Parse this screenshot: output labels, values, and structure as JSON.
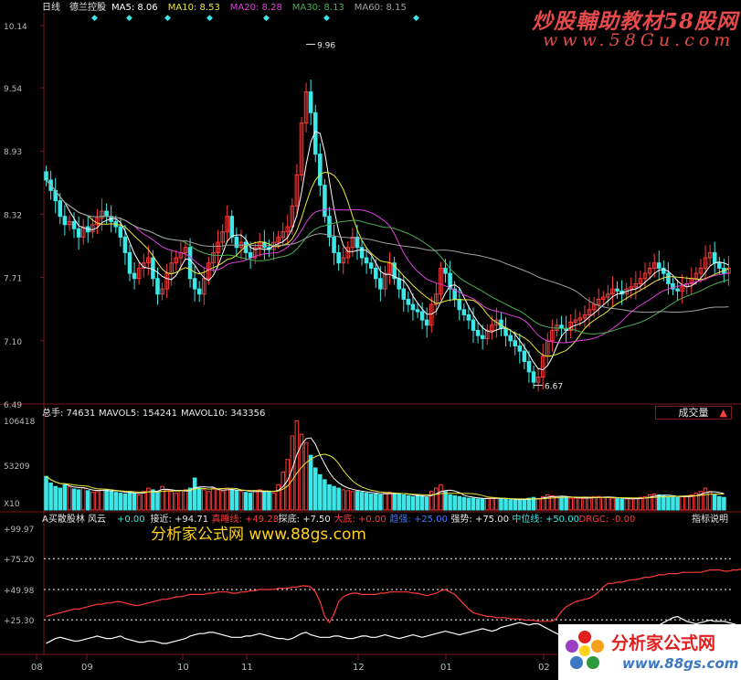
{
  "colors": {
    "up": "#ff3b3b",
    "down": "#3de7e7",
    "white": "#ffffff",
    "yellow": "#e8e83a",
    "magenta": "#e040e0",
    "green": "#4caf50",
    "grid": "#7a1a1a",
    "axis_text": "#b9b9b9"
  },
  "header": {
    "period": "日线",
    "stock": "德兰控股",
    "ma": [
      {
        "label": "MA5: 8.06",
        "color": "#ffffff"
      },
      {
        "label": "MA10: 8.53",
        "color": "#e8e83a"
      },
      {
        "label": "MA20: 8.28",
        "color": "#e040e0"
      },
      {
        "label": "MA30: 8.13",
        "color": "#4caf50"
      },
      {
        "label": "MA60: 8.15",
        "color": "#a0a0a0"
      }
    ]
  },
  "watermark": {
    "line1": "炒股輔助教材58股网",
    "line2": "www.58Gu.com",
    "line3": "分析家公式网 www.88gs.com"
  },
  "logo": {
    "title": "分析家公式网",
    "url": "www.88gs.com"
  },
  "volume_header": {
    "total": "总手: 74631",
    "mavol5": "MAVOL5: 154241",
    "mavol10": "MAVOL10: 343356",
    "button": "成交量",
    "button_icon": "▲"
  },
  "indicator_header": {
    "name": "A买散股林 风云",
    "items": [
      {
        "label": "+0.00",
        "color": "#3de7e7"
      },
      {
        "label": "接近: +94.71",
        "color": "#e8e8e8"
      },
      {
        "label": "真睡线: +49.28",
        "color": "#ff3b3b"
      },
      {
        "label": "探底: +7.50",
        "color": "#e8e8e8"
      },
      {
        "label": "大底: +0.00",
        "color": "#ff3b3b"
      },
      {
        "label": "趋强: +25.00",
        "color": "#3b78ff"
      },
      {
        "label": "强势: +75.00",
        "color": "#e8e8e8"
      },
      {
        "label": "中位线: +50.00",
        "color": "#3de7e7"
      },
      {
        "label": "DRGC: -0.00",
        "color": "#ff3b3b"
      }
    ],
    "help": "指标说明"
  },
  "chart_data": [
    {
      "type": "candlestick",
      "title": "德兰控股 日线",
      "yticks": [
        "10.14",
        "9.54",
        "8.93",
        "8.32",
        "7.71",
        "7.10",
        "6.49"
      ],
      "ylim": [
        6.49,
        10.14
      ],
      "annotations": [
        {
          "label": "9.96",
          "value": 9.96
        },
        {
          "label": "6.67",
          "value": 6.67
        }
      ],
      "closes": [
        8.65,
        8.55,
        8.45,
        8.3,
        8.22,
        8.25,
        8.18,
        8.1,
        8.2,
        8.15,
        8.22,
        8.28,
        8.35,
        8.3,
        8.25,
        8.2,
        8.1,
        7.95,
        7.75,
        7.7,
        7.8,
        7.85,
        7.9,
        7.7,
        7.55,
        7.6,
        7.75,
        7.85,
        7.9,
        7.95,
        8.0,
        7.7,
        7.6,
        7.55,
        7.7,
        7.85,
        7.95,
        8.05,
        8.15,
        8.3,
        8.1,
        8.0,
        8.05,
        7.95,
        7.9,
        8.0,
        8.05,
        8.0,
        7.98,
        8.05,
        8.1,
        8.15,
        8.2,
        8.4,
        8.7,
        9.2,
        9.5,
        9.3,
        8.9,
        8.6,
        8.3,
        8.1,
        7.95,
        7.85,
        7.9,
        8.0,
        8.1,
        8.0,
        7.9,
        7.85,
        7.8,
        7.7,
        7.6,
        7.75,
        7.85,
        7.7,
        7.6,
        7.5,
        7.45,
        7.4,
        7.38,
        7.3,
        7.25,
        7.45,
        7.55,
        7.8,
        7.75,
        7.6,
        7.5,
        7.4,
        7.35,
        7.3,
        7.2,
        7.15,
        7.12,
        7.2,
        7.25,
        7.3,
        7.22,
        7.15,
        7.1,
        7.05,
        7.0,
        6.9,
        6.8,
        6.7,
        6.75,
        6.95,
        7.1,
        7.2,
        7.25,
        7.22,
        7.2,
        7.28,
        7.3,
        7.32,
        7.35,
        7.4,
        7.45,
        7.5,
        7.52,
        7.55,
        7.6,
        7.58,
        7.55,
        7.6,
        7.62,
        7.65,
        7.7,
        7.75,
        7.8,
        7.85,
        7.8,
        7.75,
        7.65,
        7.6,
        7.58,
        7.62,
        7.65,
        7.7,
        7.75,
        7.8,
        7.9,
        7.95,
        7.85,
        7.8,
        7.75,
        7.8
      ],
      "ma_series": [
        {
          "name": "MA5",
          "color": "#ffffff",
          "period": 5
        },
        {
          "name": "MA10",
          "color": "#e8e83a",
          "period": 10
        },
        {
          "name": "MA20",
          "color": "#e040e0",
          "period": 20
        },
        {
          "name": "MA30",
          "color": "#4caf50",
          "period": 30
        },
        {
          "name": "MA60",
          "color": "#a0a0a0",
          "period": 60
        }
      ]
    },
    {
      "type": "bar",
      "title": "成交量",
      "yticks": [
        "106418",
        "53209",
        "X10"
      ],
      "ylim": [
        0,
        106418
      ],
      "volumes": [
        40000,
        32000,
        28000,
        26000,
        30000,
        28000,
        25000,
        24000,
        26000,
        23000,
        21000,
        22000,
        25000,
        24000,
        22000,
        21000,
        20000,
        19000,
        22000,
        20000,
        18000,
        22000,
        26000,
        24000,
        22000,
        28000,
        24000,
        22000,
        20000,
        23000,
        24000,
        26000,
        38000,
        26000,
        24000,
        22000,
        26000,
        24000,
        22000,
        26000,
        24000,
        23000,
        22000,
        21000,
        20000,
        23000,
        24000,
        22000,
        21000,
        20000,
        30000,
        45000,
        60000,
        88000,
        106000,
        90000,
        80000,
        65000,
        50000,
        42000,
        36000,
        30000,
        28000,
        26000,
        24000,
        23000,
        22000,
        22000,
        21000,
        20000,
        19000,
        19000,
        18000,
        20000,
        21000,
        20000,
        19000,
        18000,
        17000,
        16000,
        17000,
        16000,
        15000,
        22000,
        26000,
        30000,
        22000,
        18000,
        17000,
        16000,
        15000,
        14000,
        14000,
        13000,
        13000,
        14000,
        15000,
        14000,
        13000,
        13000,
        12000,
        12000,
        12000,
        13000,
        14000,
        15000,
        13000,
        16000,
        18000,
        17000,
        16000,
        15000,
        15000,
        14000,
        14000,
        14000,
        14000,
        15000,
        16000,
        16000,
        15000,
        15000,
        14000,
        14000,
        13000,
        13000,
        13000,
        14000,
        15000,
        16000,
        18000,
        19000,
        18000,
        17000,
        16000,
        15000,
        15000,
        16000,
        17000,
        18000,
        20000,
        22000,
        26000,
        22000,
        18000,
        16000,
        15000
      ],
      "lines": [
        {
          "name": "MAVOL5",
          "color": "#ffffff"
        },
        {
          "name": "MAVOL10",
          "color": "#e8e83a"
        }
      ]
    },
    {
      "type": "line",
      "title": "A买散股林 风云",
      "yticks": [
        "+99.97",
        "+75.20",
        "+49.98",
        "+25.30"
      ],
      "ylim": [
        0,
        100
      ],
      "series": [
        {
          "name": "真睡线",
          "color": "#ff3b3b",
          "values": [
            28,
            29,
            30,
            31,
            32,
            33,
            34,
            34,
            35,
            36,
            37,
            38,
            38,
            39,
            39,
            40,
            40,
            39,
            38,
            37,
            37,
            38,
            39,
            40,
            41,
            42,
            42,
            43,
            44,
            44,
            45,
            46,
            46,
            46,
            46,
            47,
            47,
            48,
            48,
            48,
            47,
            47,
            48,
            48,
            49,
            49,
            50,
            50,
            50,
            50,
            51,
            51,
            51,
            52,
            52,
            53,
            53,
            52,
            48,
            40,
            28,
            23,
            30,
            40,
            44,
            46,
            47,
            47,
            46,
            46,
            46,
            46,
            47,
            47,
            48,
            48,
            48,
            48,
            48,
            47,
            47,
            46,
            45,
            46,
            47,
            49,
            50,
            48,
            46,
            42,
            38,
            34,
            31,
            30,
            29,
            28,
            28,
            27,
            27,
            27,
            26,
            26,
            26,
            25,
            25,
            25,
            24,
            24,
            24,
            24,
            27,
            32,
            36,
            38,
            40,
            41,
            42,
            43,
            45,
            48,
            52,
            55,
            55,
            56,
            56,
            57,
            58,
            58,
            59,
            60,
            60,
            61,
            62,
            62,
            63,
            63,
            63,
            64,
            64,
            64,
            64,
            64,
            65,
            66,
            66,
            66,
            65,
            65,
            66,
            66,
            67,
            66,
            65,
            66,
            66
          ]
        },
        {
          "name": "强弱",
          "color": "#ffffff",
          "values": [
            6,
            8,
            10,
            11,
            10,
            9,
            8,
            8,
            9,
            10,
            11,
            12,
            11,
            10,
            10,
            11,
            12,
            10,
            9,
            8,
            7,
            7,
            8,
            8,
            7,
            6,
            6,
            7,
            8,
            9,
            10,
            12,
            13,
            14,
            14,
            15,
            15,
            14,
            13,
            12,
            11,
            11,
            11,
            12,
            12,
            13,
            14,
            13,
            12,
            11,
            10,
            10,
            9,
            10,
            12,
            14,
            15,
            13,
            12,
            11,
            11,
            11,
            12,
            12,
            11,
            10,
            10,
            11,
            12,
            12,
            11,
            11,
            12,
            13,
            12,
            11,
            10,
            11,
            12,
            13,
            12,
            11,
            12,
            13,
            14,
            15,
            16,
            15,
            14,
            13,
            14,
            15,
            16,
            17,
            18,
            17,
            16,
            17,
            19,
            20,
            21,
            22,
            23,
            22,
            21,
            22,
            22,
            20,
            18,
            16,
            14,
            12,
            11,
            12,
            14,
            13,
            12,
            12,
            11,
            10,
            10,
            11,
            12,
            12,
            11,
            11,
            11,
            12,
            13,
            14,
            16,
            18,
            21,
            23,
            25,
            27,
            28,
            26,
            24,
            23,
            22,
            23,
            24,
            25,
            24,
            24,
            24,
            23,
            22,
            21
          ]
        }
      ],
      "hlines": [
        75.2,
        49.98,
        25.3
      ]
    }
  ],
  "x_axis": {
    "labels": [
      "08",
      "09",
      "10",
      "11",
      "12",
      "01",
      "02"
    ]
  }
}
